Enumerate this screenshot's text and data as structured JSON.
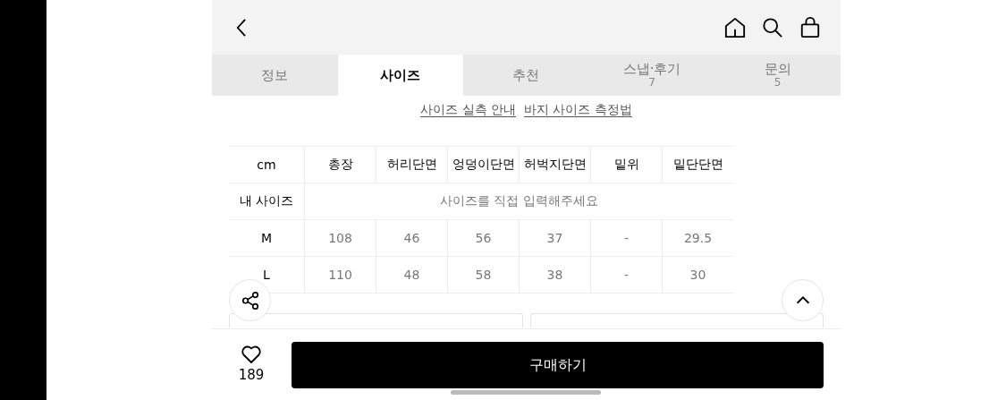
{
  "tabs": [
    {
      "label": "정보",
      "selected": false
    },
    {
      "label": "사이즈",
      "selected": true
    },
    {
      "label": "추천",
      "selected": false
    },
    {
      "label": "스냅·후기",
      "count": "7",
      "selected": false
    },
    {
      "label": "문의",
      "count": "5",
      "selected": false
    }
  ],
  "guide_links": [
    "사이즈 실측 안내",
    "바지 사이즈 측정법"
  ],
  "size_table": {
    "columns": [
      "cm",
      "총장",
      "허리단면",
      "엉덩이단면",
      "허벅지단면",
      "밑위",
      "밑단단면"
    ],
    "my_size": {
      "label": "내 사이즈",
      "placeholder": "사이즈를 직접 입력해주세요"
    },
    "rows": [
      [
        "M",
        "108",
        "46",
        "56",
        "37",
        "-",
        "29.5"
      ],
      [
        "L",
        "110",
        "48",
        "58",
        "38",
        "-",
        "30"
      ]
    ]
  },
  "like_count": "189",
  "buy_button": "구매하기"
}
